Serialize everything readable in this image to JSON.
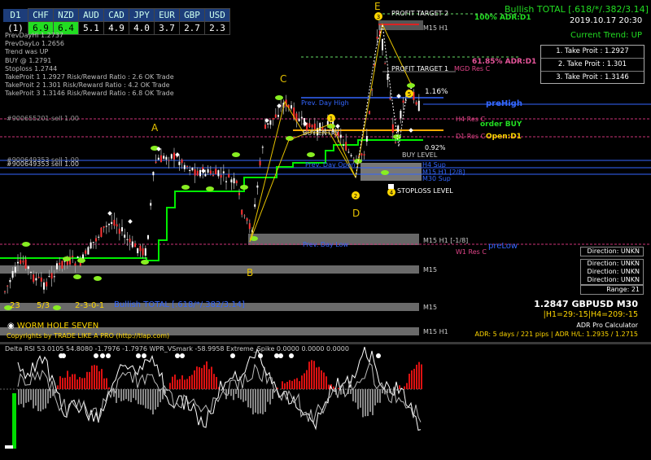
{
  "timeframe": "D1",
  "currency_table": {
    "headers": [
      "CHF",
      "NZD",
      "AUD",
      "CAD",
      "JPY",
      "EUR",
      "GBP",
      "USD"
    ],
    "row_label": "(1)",
    "values": [
      "6.9",
      "6.4",
      "5.1",
      "4.9",
      "4.0",
      "3.7",
      "2.7",
      "2.3"
    ]
  },
  "info_lines": [
    "PrevDayHi 1.2737",
    "PrevDayLo 1.2656",
    "Trend was UP",
    "BUY @ 1.2791",
    "Stoploss 1.2744",
    "TakeProit 1 1.2927 Risk/Reward Ratio : 2.6 OK Trade",
    "TakeProit 2 1.301 Risk/Reward Ratio : 4.2 OK Trade",
    "TakeProit 3 1.3146 Risk/Reward Ratio : 6.8 OK Trade"
  ],
  "orders": {
    "sell_line_1": "#900655201 sell 1.00",
    "sell_line_2": "#900649353 sell 1.00",
    "sell_line_3": "#900649353 sell 1.00"
  },
  "header_right": {
    "bullish_total": "Bullish TOTAL [.618/*/.382/3.14]",
    "adr_text": "100% ADR:D1",
    "datetime": "2019.10.17 20:30",
    "trend": "Current Trend: UP",
    "adr_fib": "61.85% ADR:D1"
  },
  "take_profits": [
    "1. Take Proit : 1.2927",
    "2. Take Proit : 1.301",
    "3. Take Proit : 1.3146"
  ],
  "chart_labels": {
    "profit_target_2": "PROFIT TARGET 2",
    "profit_target_1": "PROFIT TARGET 1",
    "m15_h1": "M15 H1",
    "m15": "M15",
    "m15_h1_fib": "M15 H1 [-1/8]",
    "mgd_res": "MGD Res C",
    "h4_res": "H4 Res C",
    "d1_res": "D1 Res C",
    "w1_res": "W1 Res C",
    "pre_high": "preHigh",
    "pre_low": "preLow",
    "order_buy": "order BUY",
    "open_d1": "Open:D1",
    "pct_1": "1.16%",
    "pct_2": "0.92%",
    "buy_level": "BUY LEVEL",
    "stoploss_level": "STOPLOSS LEVEL",
    "prev_day_high": "Prev. Day High",
    "prev_day_low": "Prev. Day Low",
    "prev_day_open": "Prev. Day Open",
    "buy_entry": "BUY ENTRY",
    "h4_sup": "H4 Sup",
    "m15_h1_sup": "M15 H1 [2/8]",
    "m30_sup": "M30 Sup",
    "wave_a": "A",
    "wave_b": "B",
    "wave_c": "C",
    "wave_d": "D",
    "wave_e": "E",
    "num_23": "23",
    "num_53": "5/3",
    "num_2301": "2-3-0-1",
    "bullish_bottom": "Bullish TOTAL [.618/*/.382/3.14]",
    "worm_hole": "WORM HOLE SEVEN",
    "copyright": "Copyrights by TRADE LIKE A PRO (http://tlap.com)"
  },
  "direction_box": {
    "top": "Direction: UNKN",
    "rows": [
      "Direction: UNKN",
      "Direction: UNKN",
      "Direction: UNKN"
    ],
    "range": "Range: 21"
  },
  "price_info": {
    "price": "1.2847 GBPUSD M30",
    "hl": "|H1=29:-15|H4=209:-15",
    "calc": "ADR Pro Calculator",
    "adr": "ADR: 5 days / 221 pips | ADR H/L: 1.2935 / 1.2715"
  },
  "subwindow": {
    "label": "Delta RSI 53.0105 54.8080 -1.7976 -1.7976  WPR_VSmark -58.9958  Extreme_Spike 0.0000 0.0000 0.0000"
  },
  "colors": {
    "background": "#000000",
    "green_line": "#00ff00",
    "gold": "#ffd700",
    "magenta": "#ff3399",
    "blue_line": "#3366ff",
    "red_bar": "#dd1111"
  }
}
